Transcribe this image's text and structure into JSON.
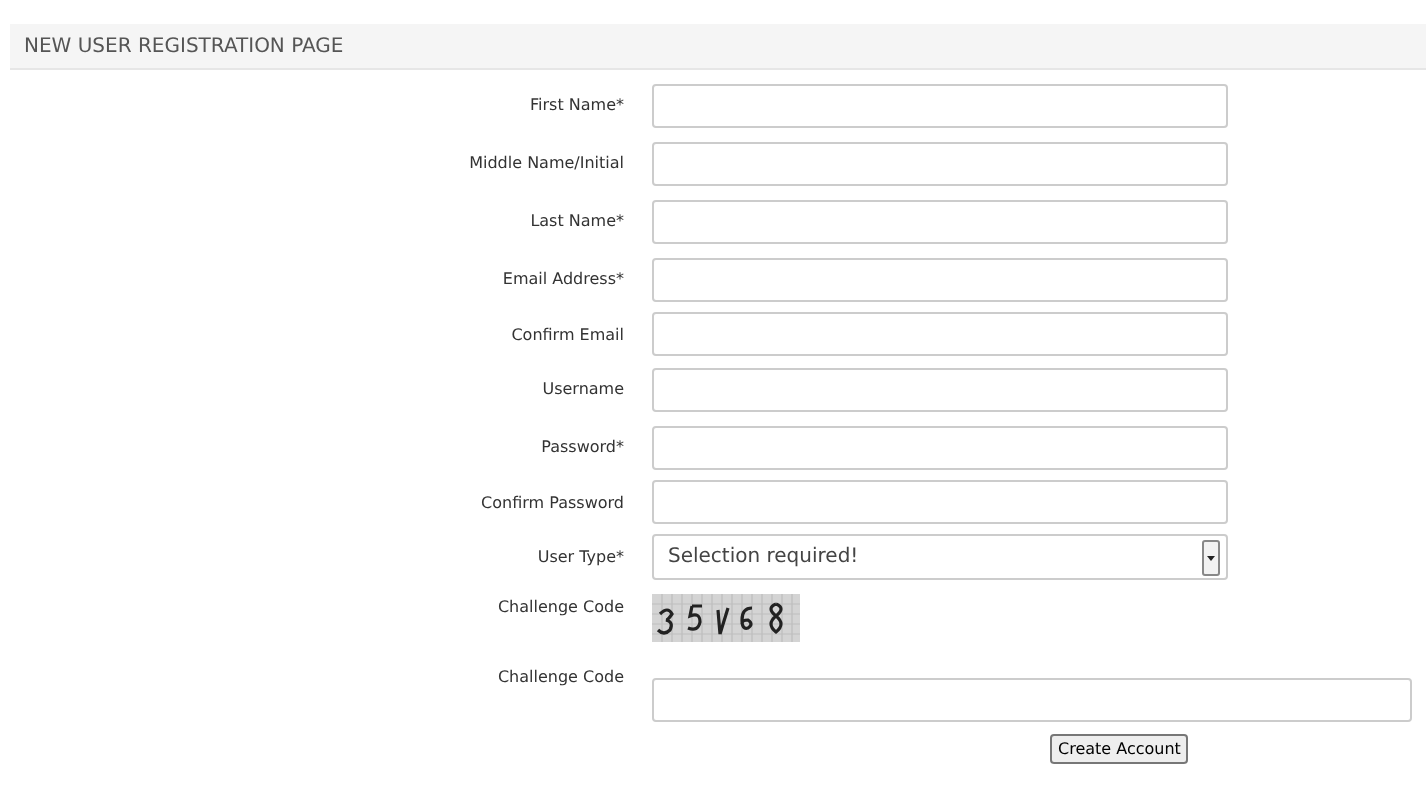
{
  "header": {
    "title": "NEW USER REGISTRATION PAGE"
  },
  "fields": [
    {
      "label": "First Name*",
      "kind": "text"
    },
    {
      "label": "Middle Name/Initial",
      "kind": "text"
    },
    {
      "label": "Last Name*",
      "kind": "text"
    },
    {
      "label": "Email Address*",
      "kind": "text"
    },
    {
      "label": "Confirm Email",
      "kind": "text"
    },
    {
      "label": "Username",
      "kind": "text"
    },
    {
      "label": "Password*",
      "kind": "text"
    },
    {
      "label": "Confirm Password",
      "kind": "text"
    },
    {
      "label": "User Type*",
      "kind": "select",
      "value": "Selection required!"
    },
    {
      "label": "Challenge Code",
      "kind": "captcha"
    },
    {
      "label": "Challenge Code",
      "kind": "wide"
    }
  ],
  "submit": {
    "label": "Create Account"
  }
}
